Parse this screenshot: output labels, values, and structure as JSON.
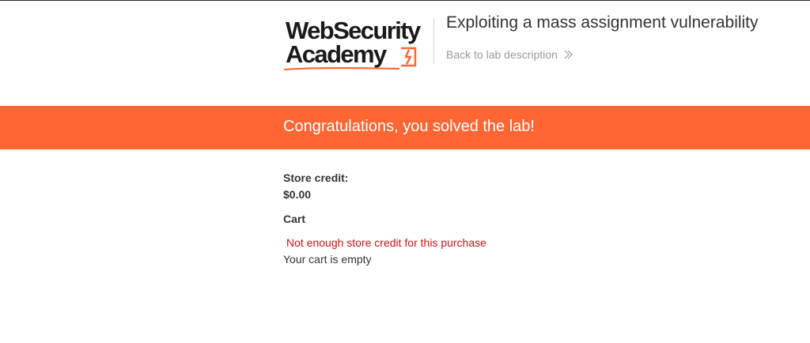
{
  "header": {
    "logo_line1": "WebSecurity",
    "logo_line2": "Academy",
    "lab_title": "Exploiting a mass assignment vulnerability",
    "back_link": "Back to lab description",
    "back_icon": "double-chevron-right-icon"
  },
  "banner": {
    "message": "Congratulations, you solved the lab!",
    "color": "#ff6633"
  },
  "account": {
    "credit_label": "Store credit:",
    "credit_value": "$0.00"
  },
  "cart": {
    "heading": "Cart",
    "error": "Not enough store credit for this purchase",
    "empty": "Your cart is empty"
  },
  "colors": {
    "accent": "#ff6633",
    "error": "#cc1111",
    "muted": "#9a9a9a"
  }
}
